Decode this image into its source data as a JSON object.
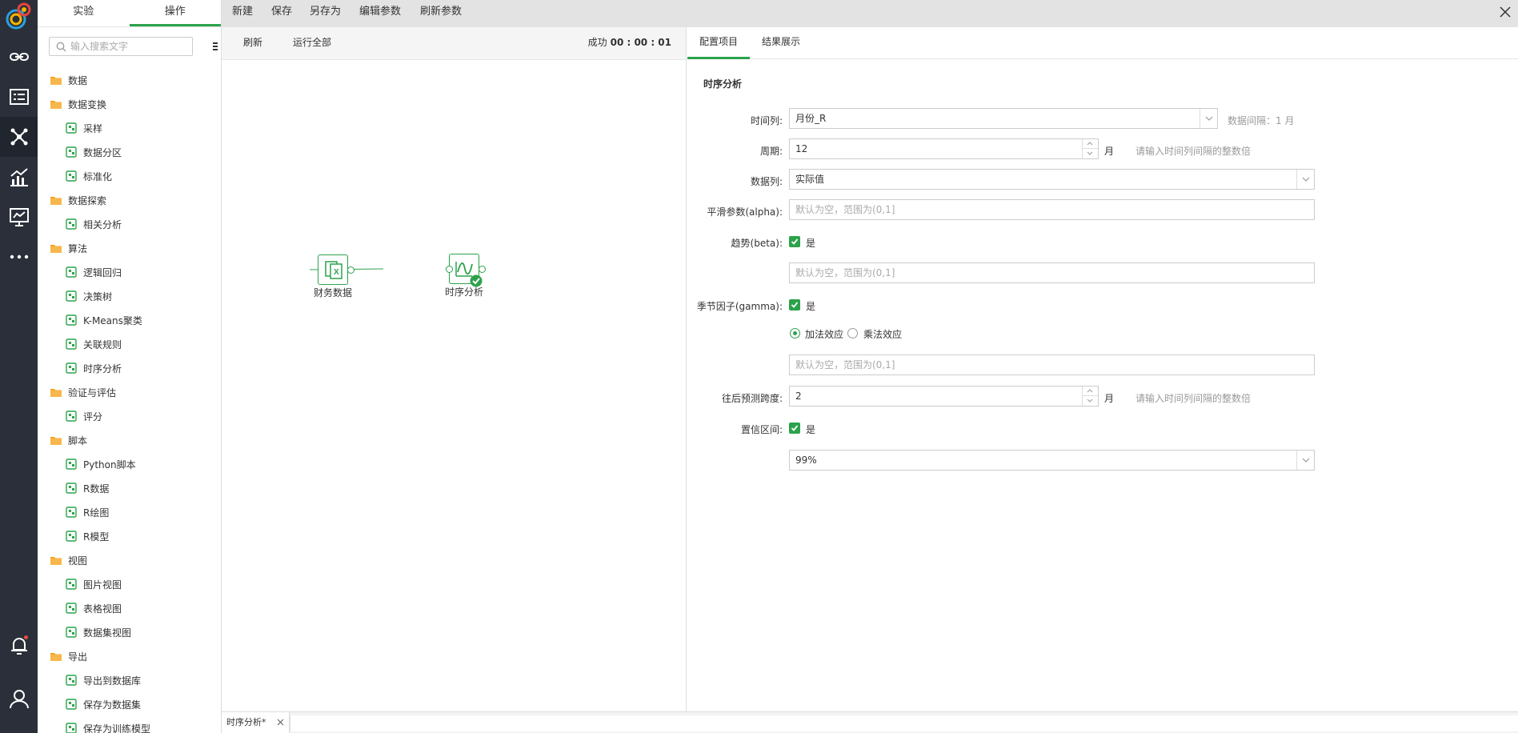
{
  "rail": {
    "items": [
      {
        "name": "link-icon"
      },
      {
        "name": "list-icon"
      },
      {
        "name": "network-icon"
      },
      {
        "name": "chart-icon"
      },
      {
        "name": "presentation-icon"
      },
      {
        "name": "more-icon"
      }
    ],
    "bottom": [
      {
        "name": "bell-icon"
      },
      {
        "name": "user-icon"
      }
    ]
  },
  "tree": {
    "tabs": [
      "实验",
      "操作"
    ],
    "active_tab": 1,
    "search_placeholder": "输入搜索文字",
    "items": [
      {
        "type": "folder",
        "label": "数据"
      },
      {
        "type": "folder",
        "label": "数据变换"
      },
      {
        "type": "leaf",
        "label": "采样"
      },
      {
        "type": "leaf",
        "label": "数据分区"
      },
      {
        "type": "leaf",
        "label": "标准化"
      },
      {
        "type": "folder",
        "label": "数据探索"
      },
      {
        "type": "leaf",
        "label": "相关分析"
      },
      {
        "type": "folder",
        "label": "算法"
      },
      {
        "type": "leaf",
        "label": "逻辑回归"
      },
      {
        "type": "leaf",
        "label": "决策树"
      },
      {
        "type": "leaf",
        "label": "K-Means聚类"
      },
      {
        "type": "leaf",
        "label": "关联规则"
      },
      {
        "type": "leaf",
        "label": "时序分析"
      },
      {
        "type": "folder",
        "label": "验证与评估"
      },
      {
        "type": "leaf",
        "label": "评分"
      },
      {
        "type": "folder",
        "label": "脚本"
      },
      {
        "type": "leaf",
        "label": "Python脚本"
      },
      {
        "type": "leaf",
        "label": "R数据"
      },
      {
        "type": "leaf",
        "label": "R绘图"
      },
      {
        "type": "leaf",
        "label": "R模型"
      },
      {
        "type": "folder",
        "label": "视图"
      },
      {
        "type": "leaf",
        "label": "图片视图"
      },
      {
        "type": "leaf",
        "label": "表格视图"
      },
      {
        "type": "leaf",
        "label": "数据集视图"
      },
      {
        "type": "folder",
        "label": "导出"
      },
      {
        "type": "leaf",
        "label": "导出到数据库"
      },
      {
        "type": "leaf",
        "label": "保存为数据集"
      },
      {
        "type": "leaf",
        "label": "保存为训练模型"
      }
    ]
  },
  "toolbar": {
    "new": "新建",
    "save": "保存",
    "save_as": "另存为",
    "edit_params": "编辑参数",
    "refresh_params": "刷新参数"
  },
  "canvas": {
    "refresh": "刷新",
    "run_all": "运行全部",
    "status_label": "成功",
    "status_time": "00 : 00 : 01",
    "nodes": [
      {
        "label": "财务数据"
      },
      {
        "label": "时序分析"
      }
    ]
  },
  "config": {
    "tabs": [
      "配置项目",
      "结果展示"
    ],
    "active_tab": 0,
    "title": "时序分析",
    "time_col_label": "时间列:",
    "time_col_value": "月份_R",
    "time_col_hint": "数据间隔：1 月",
    "period_label": "周期:",
    "period_value": "12",
    "period_unit": "月",
    "period_hint": "请输入时间列间隔的整数倍",
    "data_col_label": "数据列:",
    "data_col_value": "实际值",
    "alpha_label": "平滑参数(alpha):",
    "range_placeholder": "默认为空，范围为(0,1]",
    "beta_label": "趋势(beta):",
    "yes": "是",
    "gamma_label": "季节因子(gamma):",
    "additive": "加法效应",
    "multiplicative": "乘法效应",
    "horizon_label": "往后预测跨度:",
    "horizon_value": "2",
    "horizon_unit": "月",
    "horizon_hint": "请输入时间列间隔的整数倍",
    "ci_label": "置信区间:",
    "ci_value": "99%"
  },
  "bottom": {
    "doc_tab": "时序分析*"
  },
  "colors": {
    "accent": "#2ca24b",
    "rail": "#2b2f3a",
    "toolbar": "#e3e3e3"
  }
}
